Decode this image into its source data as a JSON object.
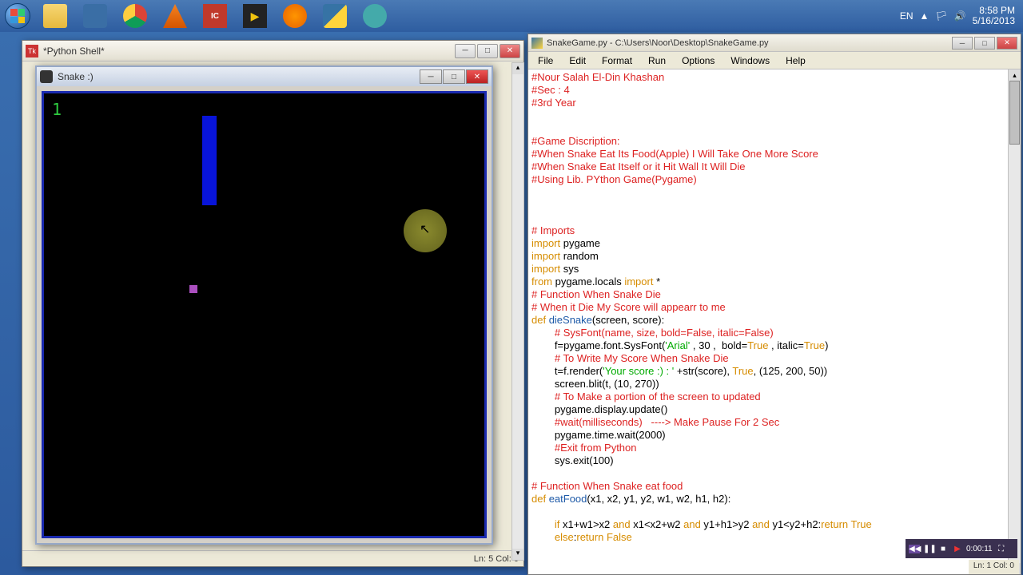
{
  "taskbar": {
    "lang": "EN",
    "time": "8:58 PM",
    "date": "5/16/2013"
  },
  "shell_window": {
    "title": "*Python Shell*",
    "status_ln": "Ln: 5",
    "status_col": "Col: 0"
  },
  "snake_window": {
    "title": "Snake :)",
    "score": "1"
  },
  "idle_window": {
    "title": "SnakeGame.py - C:\\Users\\Noor\\Desktop\\SnakeGame.py",
    "menus": [
      "File",
      "Edit",
      "Format",
      "Run",
      "Options",
      "Windows",
      "Help"
    ],
    "status_ln": "Ln: 1",
    "status_col": "Col: 0"
  },
  "code": {
    "l1": "#Nour Salah El-Din Khashan",
    "l2": "#Sec : 4",
    "l3": "#3rd Year",
    "l4": "",
    "l5": "",
    "l6": "#Game Discription:",
    "l7": "#When Snake Eat Its Food(Apple) I Will Take One More Score",
    "l8": "#When Snake Eat Itself or it Hit Wall It Will Die",
    "l9": "#Using Lib. PYthon Game(Pygame)",
    "l10": "",
    "l11": "",
    "l12": "",
    "l13": "# Imports",
    "l14a": "import",
    "l14b": " pygame",
    "l15a": "import",
    "l15b": " random",
    "l16a": "import",
    "l16b": " sys",
    "l17a": "from",
    "l17b": " pygame.locals ",
    "l17c": "import",
    "l17d": " *",
    "l18": "# Function When Snake Die",
    "l19": "# When it Die My Score will appearr to me",
    "l20a": "def ",
    "l20b": "dieSnake",
    "l20c": "(screen, score):",
    "l21": "        # SysFont(name, size, bold=False, italic=False)",
    "l22a": "        f=pygame.font.SysFont(",
    "l22b": "'Arial'",
    "l22c": " , 30 ,  bold=",
    "l22d": "True",
    "l22e": " , italic=",
    "l22f": "True",
    "l22g": ")",
    "l23": "        # To Write My Score When Snake Die",
    "l24a": "        t=f.render(",
    "l24b": "'Your score :) : '",
    "l24c": " +str(score), ",
    "l24d": "True",
    "l24e": ", (125, 200, 50))",
    "l25": "        screen.blit(t, (10, 270))",
    "l26": "        # To Make a portion of the screen to updated",
    "l27": "        pygame.display.update()",
    "l28": "        #wait(milliseconds)   ----> Make Pause For 2 Sec",
    "l29": "        pygame.time.wait(2000)",
    "l30": "        #Exit from Python",
    "l31": "        sys.exit(100)",
    "l32": "",
    "l33": "# Function When Snake eat food",
    "l34a": "def ",
    "l34b": "eatFood",
    "l34c": "(x1, x2, y1, y2, w1, w2, h1, h2):",
    "l35": "",
    "l36a": "        if",
    "l36b": " x1+w1>x2 ",
    "l36c": "and",
    "l36d": " x1<x2+w2 ",
    "l36e": "and",
    "l36f": " y1+h1>y2 ",
    "l36g": "and",
    "l36h": " y1<y2+h2:",
    "l36i": "return ",
    "l36j": "True",
    "l37a": "        else",
    "l37b": ":",
    "l37c": "return ",
    "l37d": "False"
  },
  "media": {
    "time": "0:00:11"
  }
}
